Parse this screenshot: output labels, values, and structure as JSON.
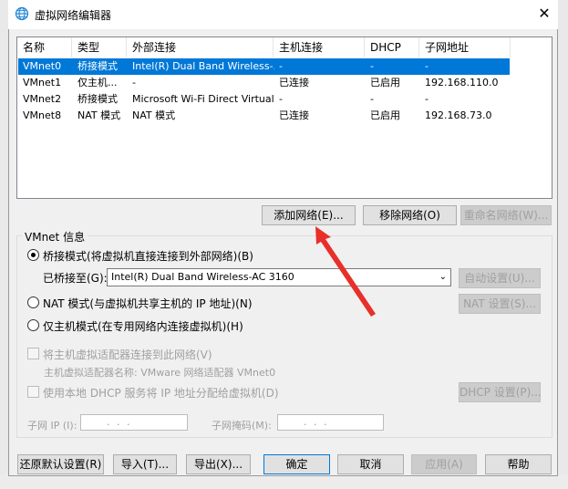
{
  "window": {
    "title": "虚拟网络编辑器",
    "close": "✕"
  },
  "table": {
    "headers": [
      "名称",
      "类型",
      "外部连接",
      "主机连接",
      "DHCP",
      "子网地址"
    ],
    "rows": [
      [
        "VMnet0",
        "桥接模式",
        "Intel(R) Dual Band Wireless-...",
        "-",
        "-",
        "-"
      ],
      [
        "VMnet1",
        "仅主机...",
        "-",
        "已连接",
        "已启用",
        "192.168.110.0"
      ],
      [
        "VMnet2",
        "桥接模式",
        "Microsoft Wi-Fi Direct Virtual...",
        "-",
        "-",
        "-"
      ],
      [
        "VMnet8",
        "NAT 模式",
        "NAT 模式",
        "已连接",
        "已启用",
        "192.168.73.0"
      ]
    ],
    "selected_row": 0
  },
  "list_buttons": {
    "add": "添加网络(E)...",
    "remove": "移除网络(O)",
    "rename": "重命名网络(W)..."
  },
  "info": {
    "group_label": "VMnet 信息",
    "bridged": "桥接模式(将虚拟机直接连接到外部网络)(B)",
    "bridged_to_label": "已桥接至(G):",
    "bridged_to_value": "Intel(R) Dual Band Wireless-AC 3160",
    "auto_settings": "自动设置(U)...",
    "nat": "NAT 模式(与虚拟机共享主机的 IP 地址)(N)",
    "nat_settings": "NAT 设置(S)...",
    "host_only": "仅主机模式(在专用网络内连接虚拟机)(H)",
    "connect_adapter": "将主机虚拟适配器连接到此网络(V)",
    "adapter_name": "主机虚拟适配器名称: VMware 网络适配器 VMnet0",
    "use_dhcp": "使用本地 DHCP 服务将 IP 地址分配给虚拟机(D)",
    "dhcp_settings": "DHCP 设置(P)...",
    "subnet_ip_label": "子网 IP (I):",
    "subnet_ip_value": ". . .",
    "subnet_mask_label": "子网掩码(M):",
    "subnet_mask_value": ". . ."
  },
  "footer": {
    "restore": "还原默认设置(R)",
    "import": "导入(T)...",
    "export": "导出(X)...",
    "ok": "确定",
    "cancel": "取消",
    "apply": "应用(A)",
    "help": "帮助"
  },
  "colors": {
    "selection": "#0078d7",
    "annotation_arrow": "#e8302a"
  }
}
